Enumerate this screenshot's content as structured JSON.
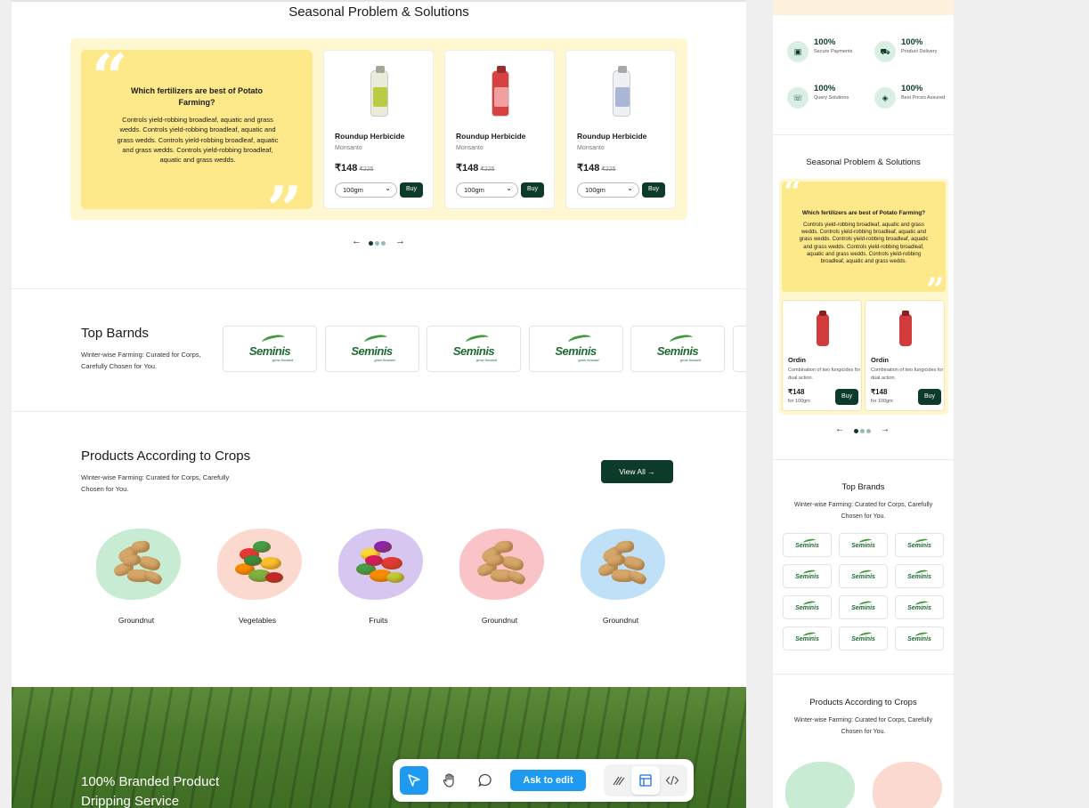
{
  "desktop": {
    "seasonal": {
      "title": "Seasonal Problem & Solutions",
      "quote_title": "Which fertilizers are best of Potato Farming?",
      "quote_body": "Controls yield-robbing broadleaf, aquatic and grass wedds. Controls yield-robbing broadleaf, aquatic and grass wedds. Controls yield-robbing broadleaf, aquatic and grass wedds. Controls yield-robbing broadleaf, aquatic and grass wedds.",
      "products": [
        {
          "name": "Roundup Herbicide",
          "brand": "Monsanto",
          "price": "₹148",
          "mrp": "₹225",
          "size": "100gm",
          "buy": "Buy",
          "color": "#e9ecd8",
          "label_color": "#b9cc43"
        },
        {
          "name": "Roundup Herbicide",
          "brand": "Monsanto",
          "price": "₹148",
          "mrp": "₹225",
          "size": "100gm",
          "buy": "Buy",
          "color": "#d94040",
          "label_color": "#f0a0a0"
        },
        {
          "name": "Roundup Herbicide",
          "brand": "Monsanto",
          "price": "₹148",
          "mrp": "₹225",
          "size": "100gm",
          "buy": "Buy",
          "color": "#eef0f4",
          "label_color": "#a9b6d6"
        }
      ],
      "pager": {
        "prev": "←",
        "next": "→"
      }
    },
    "top_brands": {
      "title": "Top Barnds",
      "subtitle": "Winter-wise Farming: Curated for Corps, Carefully Chosen for You.",
      "brand_name": "Seminis",
      "brand_tagline": "grow forward"
    },
    "crops": {
      "title": "Products According to Crops",
      "subtitle": "Winter-wise Farming: Curated for Corps, Carefully Chosen for You.",
      "view_all": "View All →",
      "items": [
        {
          "label": "Groundnut",
          "splash": "#c8ebd3"
        },
        {
          "label": "Vegetables",
          "splash": "#fbd9cf"
        },
        {
          "label": "Fruits",
          "splash": "#d7c6f0"
        },
        {
          "label": "Groundnut",
          "splash": "#f9c3c8"
        },
        {
          "label": "Groundnut",
          "splash": "#bfe0f7"
        }
      ]
    },
    "banner": {
      "line1": "100% Branded Product",
      "line2": "Dripping Service"
    }
  },
  "toolbar": {
    "ask_label": "Ask to edit",
    "icons": [
      "cursor-icon",
      "hand-icon",
      "comment-icon",
      "draw-icon",
      "layout-icon",
      "code-icon"
    ]
  },
  "mobile": {
    "features": [
      {
        "pct": "100%",
        "label": "Secure Payments"
      },
      {
        "pct": "100%",
        "label": "Product Delivery"
      },
      {
        "pct": "100%",
        "label": "Query Solutions"
      },
      {
        "pct": "100%",
        "label": "Best Prices Assured"
      }
    ],
    "seasonal_title": "Seasonal Problem & Solutions",
    "quote_title": "Which fertilizers are best of Potato Farming?",
    "quote_body": "Controls yield-robbing broadleaf, aquatic and grass wedds. Controls yield-robbing broadleaf, aquatic and grass wedds. Controls yield-robbing broadleaf, aquatic and grass wedds. Controls yield-robbing broadleaf, aquatic and grass wedds. Controls yield-robbing broadleaf, aquatic and grass wedds.",
    "products": [
      {
        "name": "Ordin",
        "desc": "Combination of two fungicides for dual action.",
        "price": "₹148",
        "unit": "for 100gm",
        "buy": "Buy"
      },
      {
        "name": "Ordin",
        "desc": "Combination of two fungicides for dual action.",
        "price": "₹148",
        "unit": "for 100gm",
        "buy": "Buy"
      }
    ],
    "top_brands_title": "Top Brands",
    "top_brands_sub": "Winter-wise Farming: Curated for Corps, Carefully Chosen for You.",
    "brand_name": "Seminis",
    "crops_title": "Products According to Crops",
    "crops_sub": "Winter-wise Farming: Curated for Corps, Carefully Chosen for You."
  },
  "colors": {
    "accent": "#0d3b2a",
    "cream": "#fff7cf",
    "yellow": "#fde98a",
    "ask_blue": "#1e9bf0"
  }
}
